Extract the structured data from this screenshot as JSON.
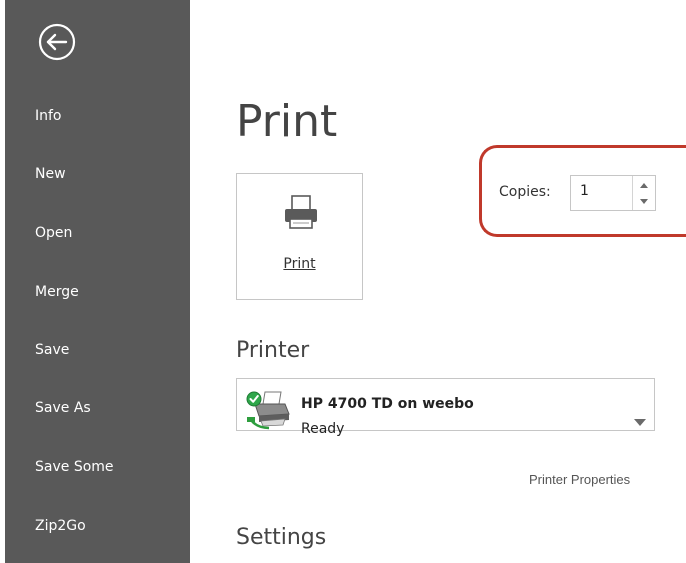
{
  "sidebar": {
    "back_icon": "back-arrow-icon",
    "items": [
      {
        "label": "Info"
      },
      {
        "label": "New"
      },
      {
        "label": "Open"
      },
      {
        "label": "Merge"
      },
      {
        "label": "Save"
      },
      {
        "label": "Save As"
      },
      {
        "label": "Save Some"
      },
      {
        "label": "Zip2Go"
      }
    ],
    "background_color": "#595959",
    "text_color": "#ffffff"
  },
  "main": {
    "title": "Print",
    "print_button": {
      "label": "Print",
      "icon": "printer-icon"
    },
    "copies": {
      "label": "Copies:",
      "value": "1",
      "highlight_color": "#c0392b"
    },
    "printer_section": {
      "heading": "Printer",
      "selected_printer": {
        "name": "HP 4700 TD on weebo",
        "status": "Ready",
        "icon": "network-printer-icon",
        "status_icon": "ready-check-icon"
      },
      "properties_link": "Printer Properties"
    },
    "settings_section": {
      "heading": "Settings"
    }
  }
}
